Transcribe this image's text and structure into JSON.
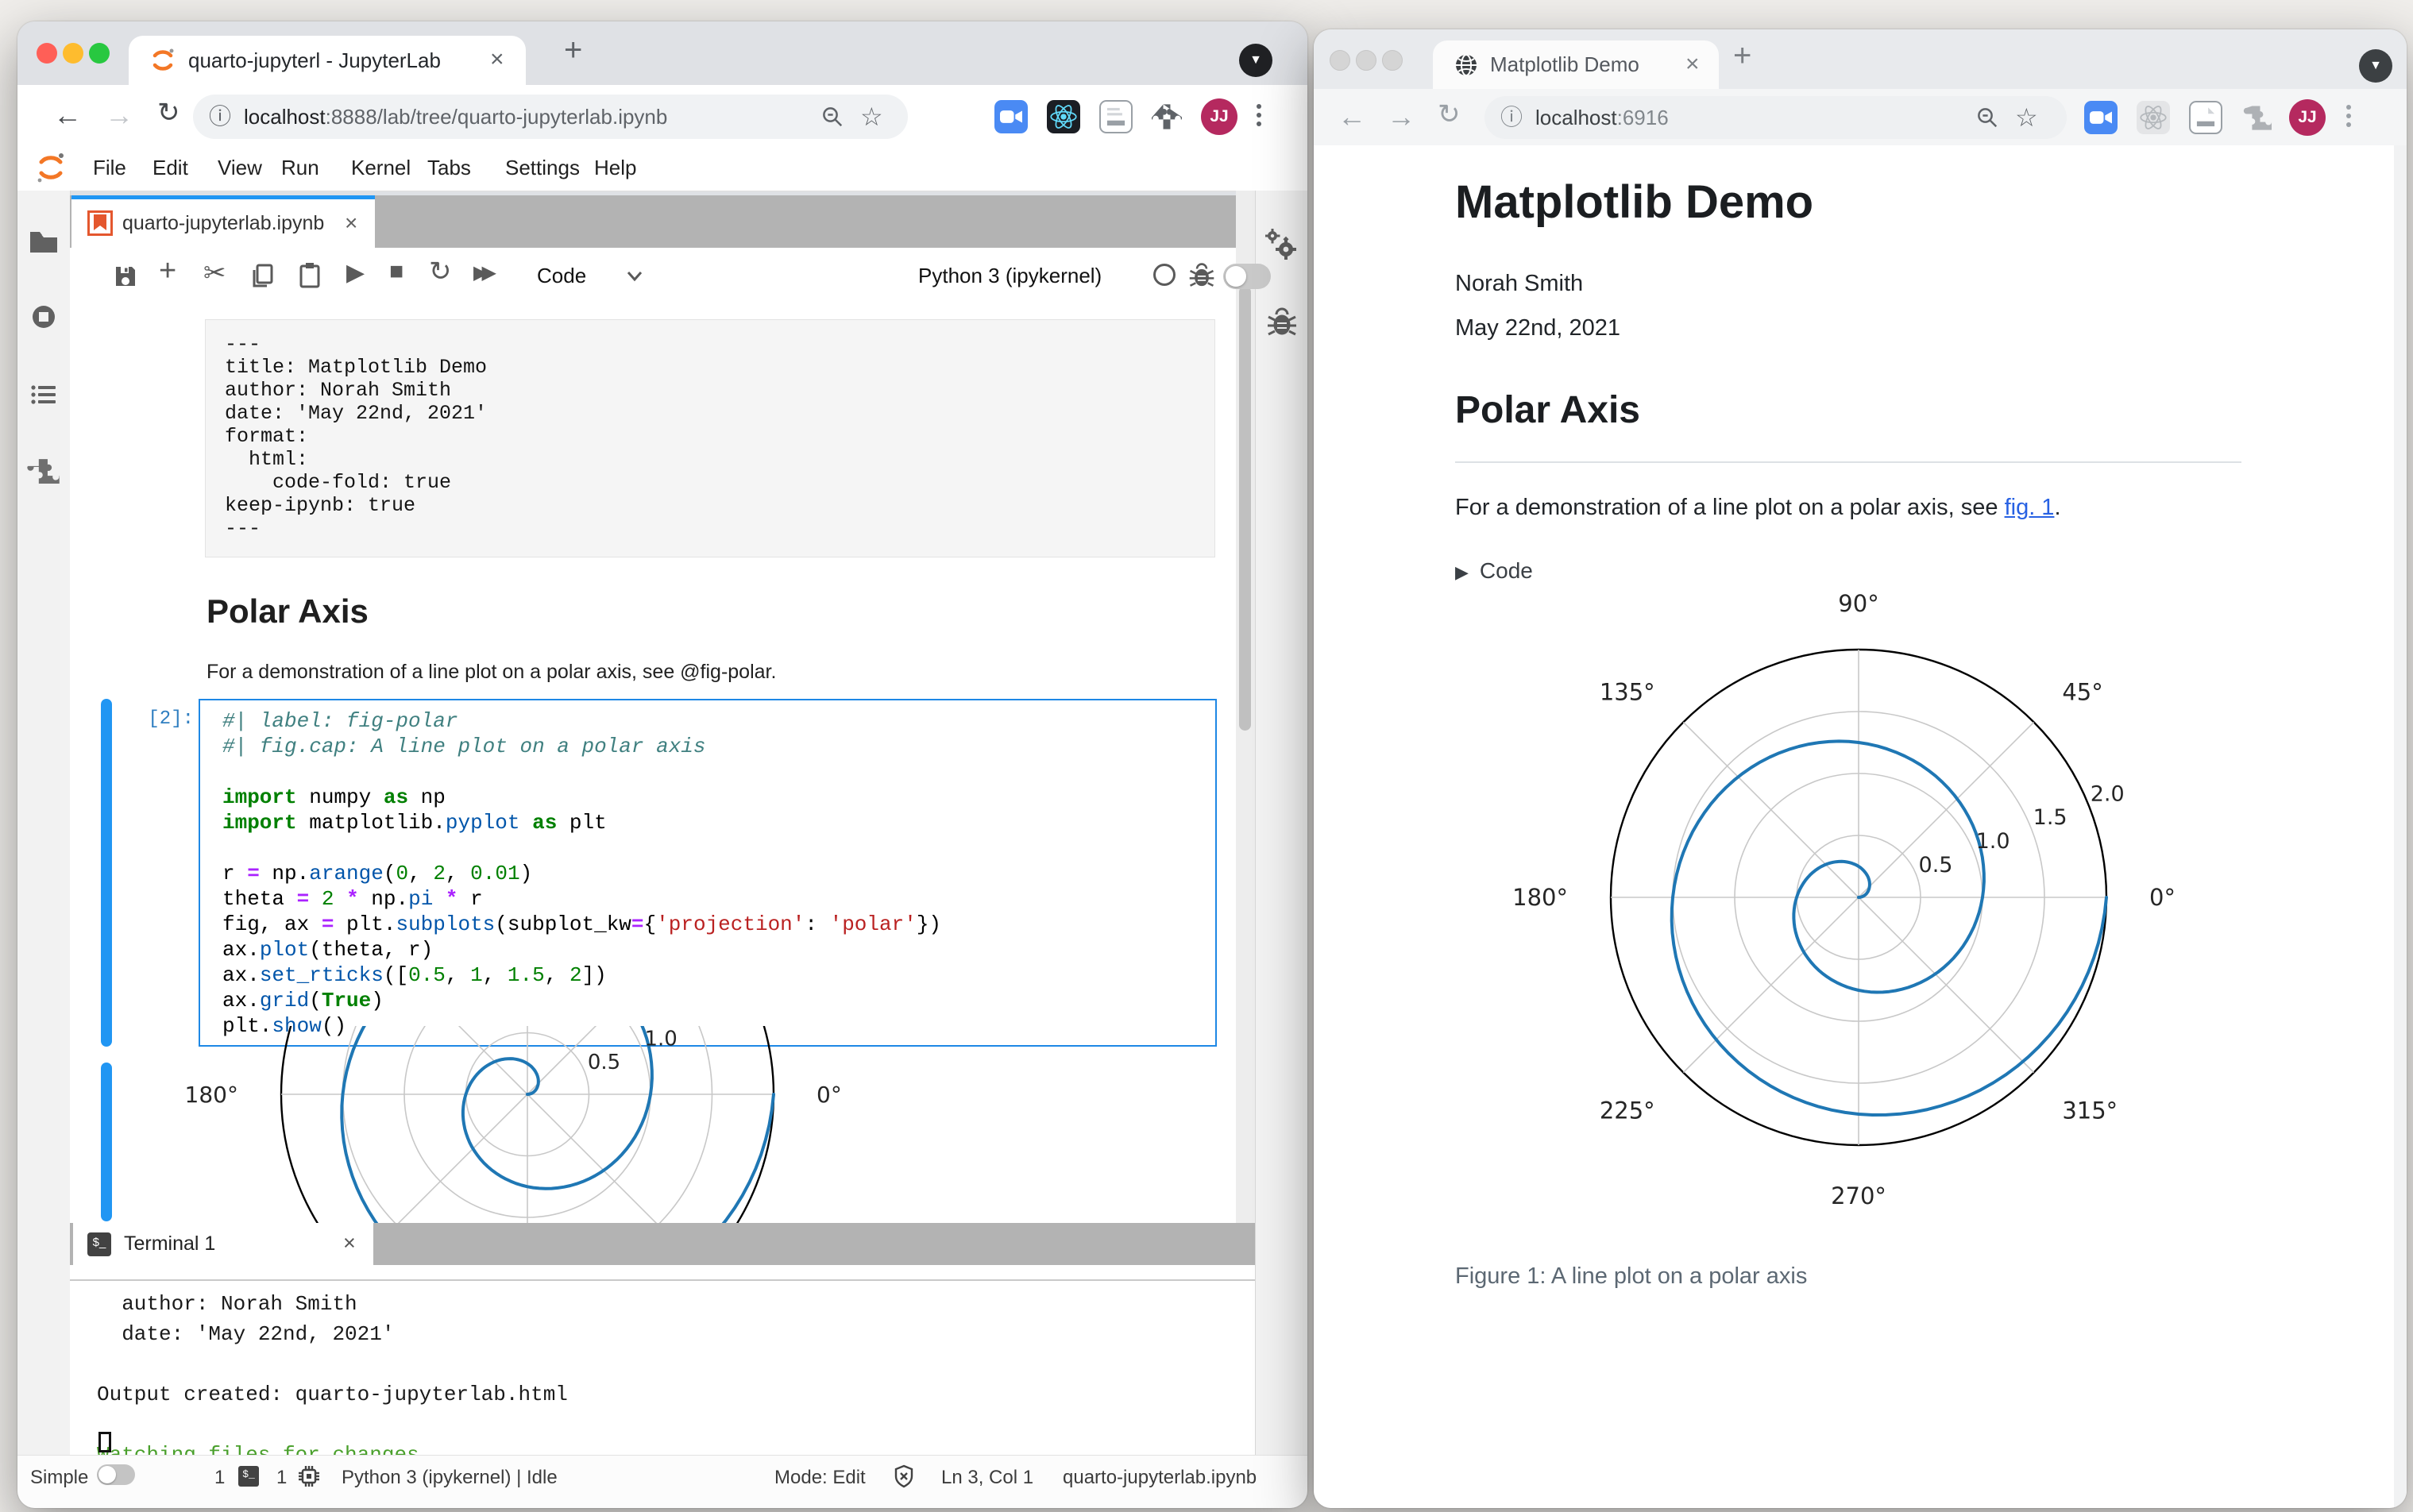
{
  "colors": {
    "accent": "#2196f3",
    "link": "#2761e3",
    "spiral": "#1f77b4",
    "prompt": "#307fc1",
    "terminal_green": "#4aa02c",
    "avatar": "#b5295f"
  },
  "left_window": {
    "browser": {
      "tab_title": "quarto-jupyterl - JupyterLab",
      "url_host": "localhost",
      "url_rest": ":8888/lab/tree/quarto-jupyterlab.ipynb",
      "avatar": "JJ"
    },
    "menu": [
      "File",
      "Edit",
      "View",
      "Run",
      "Kernel",
      "Tabs",
      "Settings",
      "Help"
    ],
    "doc_tab": "quarto-jupyterlab.ipynb",
    "toolbar": {
      "cell_type": "Code",
      "kernel_name": "Python 3 (ipykernel)"
    },
    "yaml_cell": {
      "lines": [
        "---",
        "title: Matplotlib Demo",
        "author: Norah Smith",
        "date: 'May 22nd, 2021'",
        "format:",
        "  html:",
        "    code-fold: true",
        "keep-ipynb: true",
        "---"
      ]
    },
    "markdown": {
      "heading": "Polar Axis",
      "paragraph": "For a demonstration of a line plot on a polar axis, see @fig-polar."
    },
    "code_cell": {
      "prompt": "[2]:",
      "lines": [
        [
          [
            "cm",
            "#| label: fig-polar"
          ]
        ],
        [
          [
            "cm",
            "#| fig.cap: A line plot on a polar axis"
          ]
        ],
        [],
        [
          [
            "kw",
            "import"
          ],
          [
            "t",
            " numpy "
          ],
          [
            "kw",
            "as"
          ],
          [
            "t",
            " np"
          ]
        ],
        [
          [
            "kw",
            "import"
          ],
          [
            "t",
            " matplotlib."
          ],
          [
            "pr",
            "pyplot"
          ],
          [
            "t",
            " "
          ],
          [
            "kw",
            "as"
          ],
          [
            "t",
            " plt"
          ]
        ],
        [],
        [
          [
            "t",
            "r "
          ],
          [
            "op",
            "="
          ],
          [
            "t",
            " np."
          ],
          [
            "pr",
            "arange"
          ],
          [
            "t",
            "("
          ],
          [
            "nm",
            "0"
          ],
          [
            "t",
            ", "
          ],
          [
            "nm",
            "2"
          ],
          [
            "t",
            ", "
          ],
          [
            "nm",
            "0.01"
          ],
          [
            "t",
            ")"
          ]
        ],
        [
          [
            "t",
            "theta "
          ],
          [
            "op",
            "="
          ],
          [
            "t",
            " "
          ],
          [
            "nm",
            "2"
          ],
          [
            "t",
            " "
          ],
          [
            "op",
            "*"
          ],
          [
            "t",
            " np."
          ],
          [
            "pr",
            "pi"
          ],
          [
            "t",
            " "
          ],
          [
            "op",
            "*"
          ],
          [
            "t",
            " r"
          ]
        ],
        [
          [
            "t",
            "fig, ax "
          ],
          [
            "op",
            "="
          ],
          [
            "t",
            " plt."
          ],
          [
            "pr",
            "subplots"
          ],
          [
            "t",
            "(subplot_kw"
          ],
          [
            "op",
            "="
          ],
          [
            "t",
            "{"
          ],
          [
            "st",
            "'projection'"
          ],
          [
            "t",
            ": "
          ],
          [
            "st",
            "'polar'"
          ],
          [
            "t",
            "})"
          ]
        ],
        [
          [
            "t",
            "ax."
          ],
          [
            "pr",
            "plot"
          ],
          [
            "t",
            "(theta, r)"
          ]
        ],
        [
          [
            "t",
            "ax."
          ],
          [
            "pr",
            "set_rticks"
          ],
          [
            "t",
            "(["
          ],
          [
            "nm",
            "0.5"
          ],
          [
            "t",
            ", "
          ],
          [
            "nm",
            "1"
          ],
          [
            "t",
            ", "
          ],
          [
            "nm",
            "1.5"
          ],
          [
            "t",
            ", "
          ],
          [
            "nm",
            "2"
          ],
          [
            "t",
            "])"
          ]
        ],
        [
          [
            "t",
            "ax."
          ],
          [
            "pr",
            "grid"
          ],
          [
            "t",
            "("
          ],
          [
            "kw",
            "True"
          ],
          [
            "t",
            ")"
          ]
        ],
        [
          [
            "t",
            "plt."
          ],
          [
            "pr",
            "show"
          ],
          [
            "t",
            "()"
          ]
        ]
      ]
    },
    "terminal": {
      "tab_label": "Terminal 1",
      "lines": [
        [
          "",
          "  author: Norah Smith"
        ],
        [
          "",
          "  date: 'May 22nd, 2021'"
        ],
        [
          "",
          ""
        ],
        [
          "",
          "Output created: quarto-jupyterlab.html"
        ],
        [
          "",
          ""
        ],
        [
          "green",
          "Watching files for changes"
        ]
      ]
    },
    "statusbar": {
      "mode_label": "Simple",
      "terminals_count": "1",
      "kernels_count": "1",
      "kernel_status": "Python 3 (ipykernel) | Idle",
      "mode": "Mode: Edit",
      "cursor_pos": "Ln 3, Col 1",
      "filename": "quarto-jupyterlab.ipynb"
    }
  },
  "right_window": {
    "browser": {
      "tab_title": "Matplotlib Demo",
      "url_host": "localhost",
      "url_rest": ":6916",
      "avatar": "JJ"
    },
    "page": {
      "title": "Matplotlib Demo",
      "author": "Norah Smith",
      "date": "May 22nd, 2021",
      "section_heading": "Polar Axis",
      "para_prefix": "For a demonstration of a line plot on a polar axis, see ",
      "link_text": "fig. 1",
      "para_suffix": ".",
      "code_toggle": "Code",
      "figure_caption": "Figure 1: A line plot on a polar axis"
    }
  },
  "chart_data": {
    "type": "line",
    "projection": "polar",
    "description": "Archimedean spiral: r from 0 to 2 plotted against theta = 2*pi*r (two full counterclockwise turns, line ends at r=2 at 0°)",
    "r_start": 0,
    "r_end": 2,
    "r_step": 0.01,
    "theta_formula": "theta = 2 * pi * r",
    "r_ticks": [
      0.5,
      1,
      1.5,
      2
    ],
    "r_tick_labels": [
      "0.5",
      "1.0",
      "1.5",
      "2.0"
    ],
    "theta_labels": [
      "0°",
      "45°",
      "90°",
      "135°",
      "180°",
      "225°",
      "270°",
      "315°"
    ],
    "rlabel_angle_deg": 22.5,
    "r_max": 2,
    "grid": true,
    "line_color": "#1f77b4",
    "grid_color": "#c8c8c8",
    "spine_color": "#000000",
    "caption": "Figure 1: A line plot on a polar axis"
  }
}
